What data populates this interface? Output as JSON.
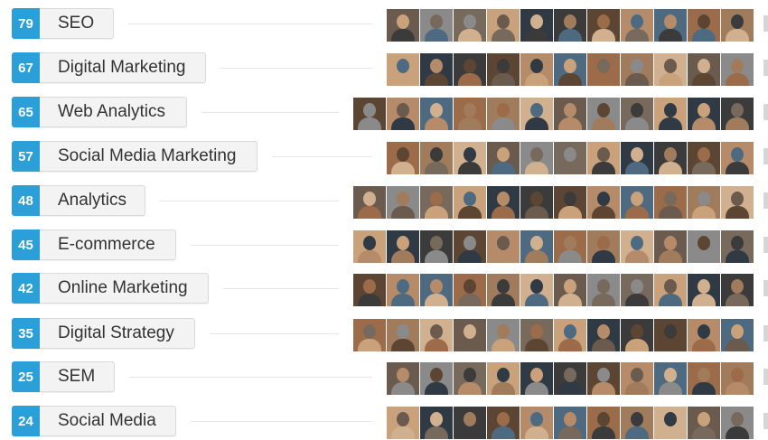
{
  "skills": [
    {
      "count": "79",
      "name": "SEO"
    },
    {
      "count": "67",
      "name": "Digital Marketing"
    },
    {
      "count": "65",
      "name": "Web Analytics"
    },
    {
      "count": "57",
      "name": "Social Media Marketing"
    },
    {
      "count": "48",
      "name": "Analytics"
    },
    {
      "count": "45",
      "name": "E-commerce"
    },
    {
      "count": "42",
      "name": "Online Marketing"
    },
    {
      "count": "35",
      "name": "Digital Strategy"
    },
    {
      "count": "25",
      "name": "SEM"
    },
    {
      "count": "24",
      "name": "Social Media"
    }
  ],
  "endorser_photo_counts": [
    11,
    11,
    12,
    11,
    12,
    12,
    12,
    12,
    11,
    11
  ],
  "colors": {
    "badge": "#2a9fd8",
    "pill": "#f3f3f3",
    "avatar_tones": [
      "#6b5a4e",
      "#3b3b3b",
      "#a07b5c",
      "#c9a27c",
      "#4e6a80",
      "#8a8a8a",
      "#5c4633",
      "#d1b08f",
      "#2f3a44",
      "#9c6b4a",
      "#77695c",
      "#b58b6a"
    ]
  },
  "icons": {
    "avatar": "endorser-photo"
  }
}
